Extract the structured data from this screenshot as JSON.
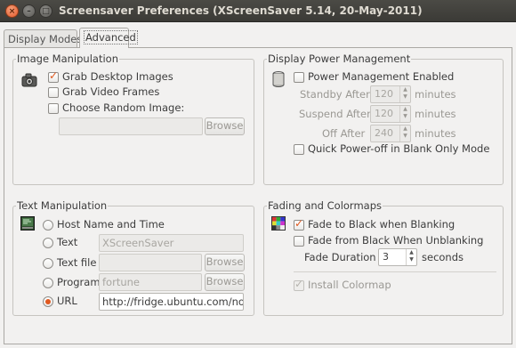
{
  "window": {
    "title": "Screensaver Preferences  (XScreenSaver 5.14, 20-May-2011)",
    "close_glyph": "×",
    "min_glyph": "–",
    "max_glyph": "□"
  },
  "tabs": [
    {
      "label": "Display Modes",
      "active": false
    },
    {
      "label": "Advanced",
      "active": true
    }
  ],
  "image_manipulation": {
    "title": "Image Manipulation",
    "grab_desktop": {
      "label": "Grab Desktop Images",
      "checked": true
    },
    "grab_video": {
      "label": "Grab Video Frames",
      "checked": false
    },
    "choose_random": {
      "label": "Choose Random Image:",
      "checked": false
    },
    "path_value": "",
    "browse_label": "Browse"
  },
  "display_power": {
    "title": "Display Power Management",
    "enabled": {
      "label": "Power Management Enabled",
      "checked": false
    },
    "standby": {
      "label": "Standby After",
      "value": "120",
      "unit": "minutes"
    },
    "suspend": {
      "label": "Suspend After",
      "value": "120",
      "unit": "minutes"
    },
    "off": {
      "label": "Off After",
      "value": "240",
      "unit": "minutes"
    },
    "quick_off": {
      "label": "Quick Power-off in Blank Only Mode",
      "checked": false
    }
  },
  "text_manipulation": {
    "title": "Text Manipulation",
    "host_name": {
      "label": "Host Name and Time",
      "selected": false
    },
    "text": {
      "label": "Text",
      "value": "XScreenSaver",
      "selected": false
    },
    "text_file": {
      "label": "Text file",
      "value": "",
      "browse_label": "Browse",
      "selected": false
    },
    "program": {
      "label": "Program",
      "value": "fortune",
      "browse_label": "Browse",
      "selected": false
    },
    "url": {
      "label": "URL",
      "value": "http://fridge.ubuntu.com/node/",
      "selected": true
    }
  },
  "fading": {
    "title": "Fading and Colormaps",
    "fade_to_black": {
      "label": "Fade to Black when Blanking",
      "checked": true
    },
    "fade_from_black": {
      "label": "Fade from Black When Unblanking",
      "checked": false
    },
    "duration": {
      "label": "Fade Duration",
      "value": "3",
      "unit": "seconds"
    },
    "install_colormap": {
      "label": "Install Colormap",
      "checked": true,
      "disabled": true
    }
  },
  "colors": {
    "accent": "#e0581e",
    "titlebar": "#3c3b37"
  }
}
